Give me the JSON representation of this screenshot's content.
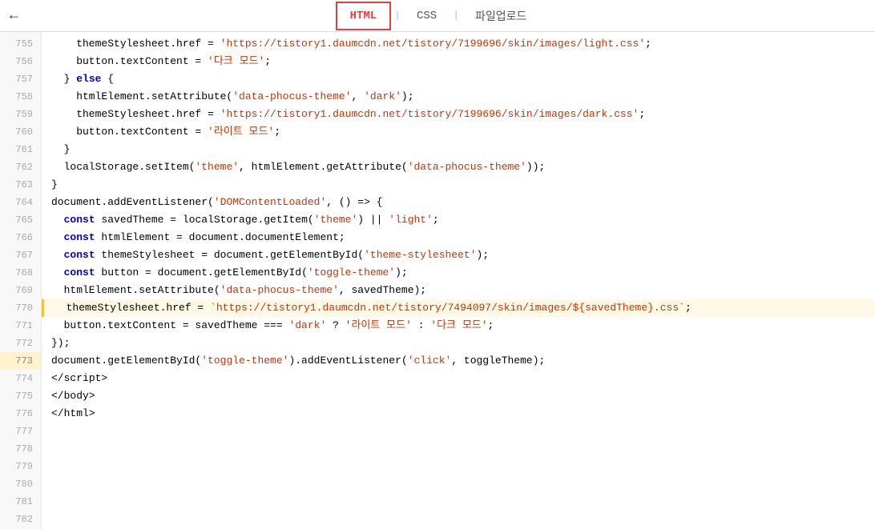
{
  "nav": {
    "back_label": "←",
    "tabs": [
      {
        "id": "html",
        "label": "HTML",
        "active": true
      },
      {
        "id": "css",
        "label": "CSS",
        "active": false
      },
      {
        "id": "file-upload",
        "label": "파일업로드",
        "active": false
      }
    ]
  },
  "code": {
    "lines": [
      {
        "num": 755,
        "highlighted": false,
        "content": [
          {
            "type": "plain",
            "text": "    themeStylesheet.href = "
          },
          {
            "type": "str",
            "text": "'https://tistory1.daumcdn.net/tistory/7199696/skin/images/light.css'"
          },
          {
            "type": "plain",
            "text": ";"
          }
        ]
      },
      {
        "num": 756,
        "highlighted": false,
        "content": [
          {
            "type": "plain",
            "text": "    button.textContent = "
          },
          {
            "type": "str",
            "text": "'다크 모드'"
          },
          {
            "type": "plain",
            "text": ";"
          }
        ]
      },
      {
        "num": 757,
        "highlighted": false,
        "content": [
          {
            "type": "plain",
            "text": "  } "
          },
          {
            "type": "kw",
            "text": "else"
          },
          {
            "type": "plain",
            "text": " {"
          }
        ]
      },
      {
        "num": 758,
        "highlighted": false,
        "content": [
          {
            "type": "plain",
            "text": "    htmlElement.setAttribute("
          },
          {
            "type": "str",
            "text": "'data-phocus-theme'"
          },
          {
            "type": "plain",
            "text": ", "
          },
          {
            "type": "str",
            "text": "'dark'"
          },
          {
            "type": "plain",
            "text": ");"
          }
        ]
      },
      {
        "num": 759,
        "highlighted": false,
        "content": [
          {
            "type": "plain",
            "text": "    themeStylesheet.href = "
          },
          {
            "type": "str",
            "text": "'https://tistory1.daumcdn.net/tistory/7199696/skin/images/dark.css'"
          },
          {
            "type": "plain",
            "text": ";"
          }
        ]
      },
      {
        "num": 760,
        "highlighted": false,
        "content": [
          {
            "type": "plain",
            "text": "    button.textContent = "
          },
          {
            "type": "str",
            "text": "'라이트 모드'"
          },
          {
            "type": "plain",
            "text": ";"
          }
        ]
      },
      {
        "num": 761,
        "highlighted": false,
        "content": [
          {
            "type": "plain",
            "text": "  }"
          }
        ]
      },
      {
        "num": 762,
        "highlighted": false,
        "content": [
          {
            "type": "plain",
            "text": ""
          }
        ]
      },
      {
        "num": 763,
        "highlighted": false,
        "content": [
          {
            "type": "plain",
            "text": "  localStorage.setItem("
          },
          {
            "type": "str",
            "text": "'theme'"
          },
          {
            "type": "plain",
            "text": ", htmlElement.getAttribute("
          },
          {
            "type": "str",
            "text": "'data-phocus-theme'"
          },
          {
            "type": "plain",
            "text": "));"
          }
        ]
      },
      {
        "num": 764,
        "highlighted": false,
        "content": [
          {
            "type": "plain",
            "text": "}"
          }
        ]
      },
      {
        "num": 765,
        "highlighted": false,
        "content": [
          {
            "type": "plain",
            "text": ""
          }
        ]
      },
      {
        "num": 766,
        "highlighted": false,
        "content": [
          {
            "type": "plain",
            "text": "document.addEventListener("
          },
          {
            "type": "str",
            "text": "'DOMContentLoaded'"
          },
          {
            "type": "plain",
            "text": ", () => {"
          }
        ]
      },
      {
        "num": 767,
        "highlighted": false,
        "content": [
          {
            "type": "plain",
            "text": "  "
          },
          {
            "type": "kw",
            "text": "const"
          },
          {
            "type": "plain",
            "text": " savedTheme = localStorage.getItem("
          },
          {
            "type": "str",
            "text": "'theme'"
          },
          {
            "type": "plain",
            "text": ") || "
          },
          {
            "type": "str",
            "text": "'light'"
          },
          {
            "type": "plain",
            "text": ";"
          }
        ]
      },
      {
        "num": 768,
        "highlighted": false,
        "content": [
          {
            "type": "plain",
            "text": "  "
          },
          {
            "type": "kw",
            "text": "const"
          },
          {
            "type": "plain",
            "text": " htmlElement = document.documentElement;"
          }
        ]
      },
      {
        "num": 769,
        "highlighted": false,
        "content": [
          {
            "type": "plain",
            "text": "  "
          },
          {
            "type": "kw",
            "text": "const"
          },
          {
            "type": "plain",
            "text": " themeStylesheet = document.getElementById("
          },
          {
            "type": "str",
            "text": "'theme-stylesheet'"
          },
          {
            "type": "plain",
            "text": ");"
          }
        ]
      },
      {
        "num": 770,
        "highlighted": false,
        "content": [
          {
            "type": "plain",
            "text": "  "
          },
          {
            "type": "kw",
            "text": "const"
          },
          {
            "type": "plain",
            "text": " button = document.getElementById("
          },
          {
            "type": "str",
            "text": "'toggle-theme'"
          },
          {
            "type": "plain",
            "text": ");"
          }
        ]
      },
      {
        "num": 771,
        "highlighted": false,
        "content": [
          {
            "type": "plain",
            "text": ""
          }
        ]
      },
      {
        "num": 772,
        "highlighted": false,
        "content": [
          {
            "type": "plain",
            "text": "  htmlElement.setAttribute("
          },
          {
            "type": "str",
            "text": "'data-phocus-theme'"
          },
          {
            "type": "plain",
            "text": ", savedTheme);"
          }
        ]
      },
      {
        "num": 773,
        "highlighted": true,
        "content": [
          {
            "type": "plain",
            "text": "  themeStylesheet.href = "
          },
          {
            "type": "str",
            "text": "`https://tistory1.daumcdn.net/tistory/7494097/skin/images/${savedTheme}.css`"
          },
          {
            "type": "plain",
            "text": ";"
          }
        ]
      },
      {
        "num": 774,
        "highlighted": false,
        "content": [
          {
            "type": "plain",
            "text": ""
          }
        ]
      },
      {
        "num": 775,
        "highlighted": false,
        "content": [
          {
            "type": "plain",
            "text": "  button.textContent = savedTheme === "
          },
          {
            "type": "str",
            "text": "'dark'"
          },
          {
            "type": "plain",
            "text": " ? "
          },
          {
            "type": "str",
            "text": "'라이트 모드'"
          },
          {
            "type": "plain",
            "text": " : "
          },
          {
            "type": "str",
            "text": "'다크 모드'"
          },
          {
            "type": "plain",
            "text": ";"
          }
        ]
      },
      {
        "num": 776,
        "highlighted": false,
        "content": [
          {
            "type": "plain",
            "text": "});"
          }
        ]
      },
      {
        "num": 777,
        "highlighted": false,
        "content": [
          {
            "type": "plain",
            "text": ""
          }
        ]
      },
      {
        "num": 778,
        "highlighted": false,
        "content": [
          {
            "type": "plain",
            "text": "document.getElementById("
          },
          {
            "type": "str",
            "text": "'toggle-theme'"
          },
          {
            "type": "plain",
            "text": ").addEventListener("
          },
          {
            "type": "str",
            "text": "'click'"
          },
          {
            "type": "plain",
            "text": ", toggleTheme);"
          }
        ]
      },
      {
        "num": 779,
        "highlighted": false,
        "content": [
          {
            "type": "plain",
            "text": "</"
          },
          {
            "type": "plain",
            "text": "script>"
          }
        ]
      },
      {
        "num": 780,
        "highlighted": false,
        "content": [
          {
            "type": "plain",
            "text": "</"
          },
          {
            "type": "plain",
            "text": "body>"
          }
        ]
      },
      {
        "num": 781,
        "highlighted": false,
        "content": [
          {
            "type": "plain",
            "text": ""
          }
        ]
      },
      {
        "num": 782,
        "highlighted": false,
        "content": [
          {
            "type": "plain",
            "text": "</"
          },
          {
            "type": "plain",
            "text": "html>"
          }
        ]
      }
    ]
  }
}
